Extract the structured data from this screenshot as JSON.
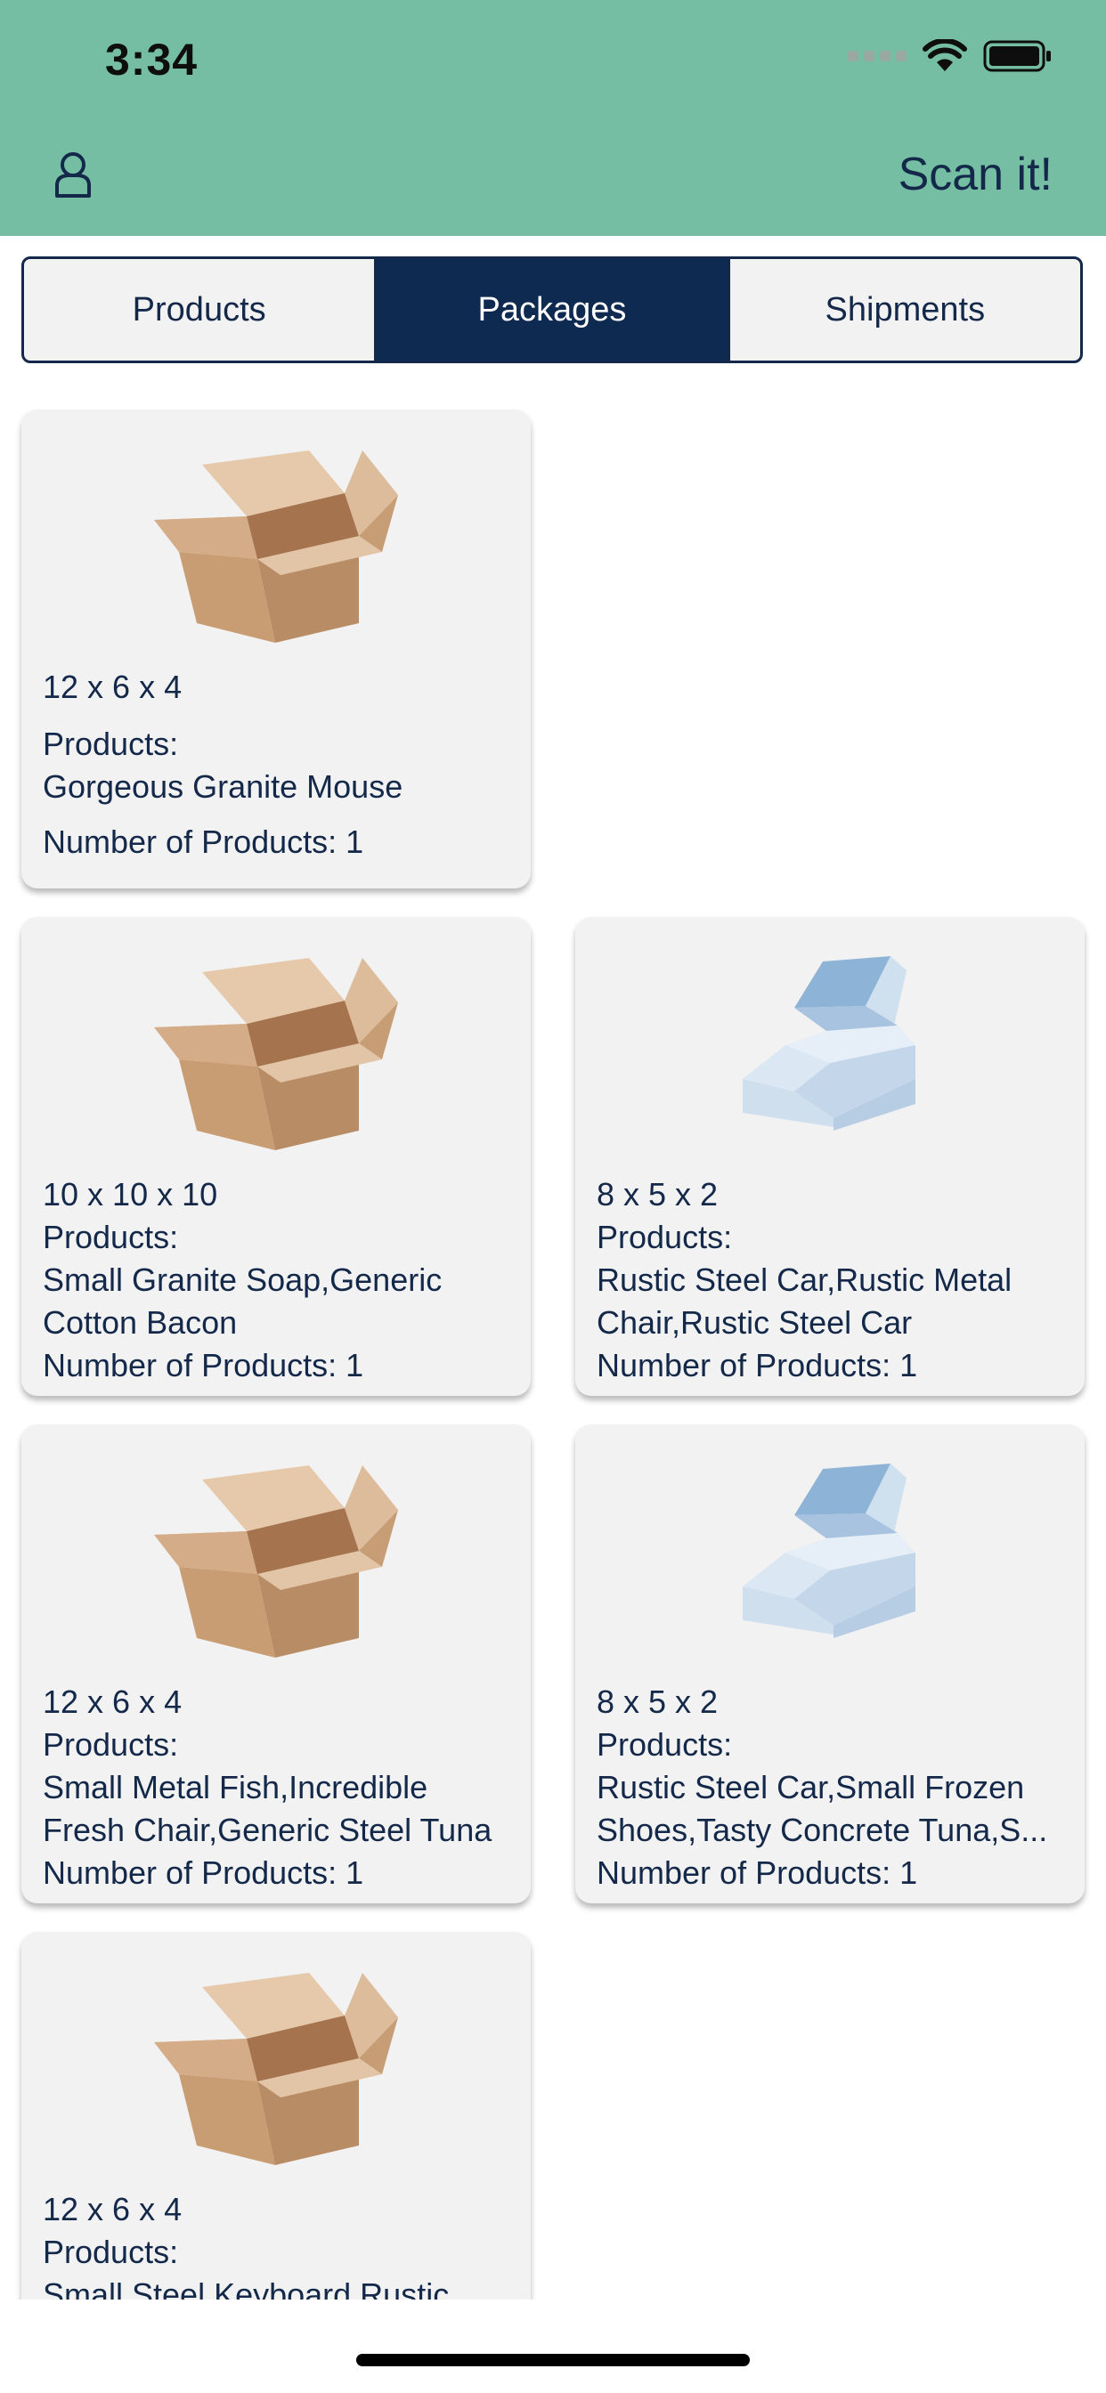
{
  "status_bar": {
    "time": "3:34"
  },
  "header": {
    "action_label": "Scan it!"
  },
  "tabs": [
    {
      "label": "Products",
      "selected": false
    },
    {
      "label": "Packages",
      "selected": true
    },
    {
      "label": "Shipments",
      "selected": false
    }
  ],
  "packages": [
    {
      "dimensions": "12 x 6 x 4",
      "products_label": "Products:",
      "products_line1": "Gorgeous Granite Mouse",
      "products_line2": "",
      "count_label": "Number of Products: 1",
      "image": "brown-cardboard-box"
    },
    {
      "dimensions": "10 x 10 x 10",
      "products_label": "Products:",
      "products_line1": "Small Granite Soap,Generic",
      "products_line2": "Cotton Bacon",
      "count_label": "Number of Products: 1",
      "image": "brown-cardboard-box"
    },
    {
      "dimensions": "8 x 5 x 2",
      "products_label": "Products:",
      "products_line1": "Rustic Steel Car,Rustic Metal",
      "products_line2": "Chair,Rustic Steel Car",
      "count_label": "Number of Products: 1",
      "image": "blue-mailer-box"
    },
    {
      "dimensions": "12 x 6 x 4",
      "products_label": "Products:",
      "products_line1": "Small Metal Fish,Incredible",
      "products_line2": "Fresh Chair,Generic Steel Tuna",
      "count_label": "Number of Products: 1",
      "image": "brown-cardboard-box"
    },
    {
      "dimensions": "8 x 5 x 2",
      "products_label": "Products:",
      "products_line1": "Rustic Steel Car,Small Frozen",
      "products_line2": "Shoes,Tasty Concrete Tuna,S...",
      "count_label": "Number of Products: 1",
      "image": "blue-mailer-box"
    },
    {
      "dimensions": "12 x 6 x 4",
      "products_label": "Products:",
      "products_line1": "Small Steel Keyboard,Rustic",
      "products_line2": "",
      "count_label": "",
      "image": "brown-cardboard-box"
    }
  ],
  "colors": {
    "header": "#75bea4",
    "selected_tab": "#0f2a50",
    "text": "#14294a",
    "card": "#f2f2f2"
  },
  "icons": [
    "user-icon",
    "wifi-icon",
    "battery-icon",
    "cellular-signal-icon"
  ]
}
